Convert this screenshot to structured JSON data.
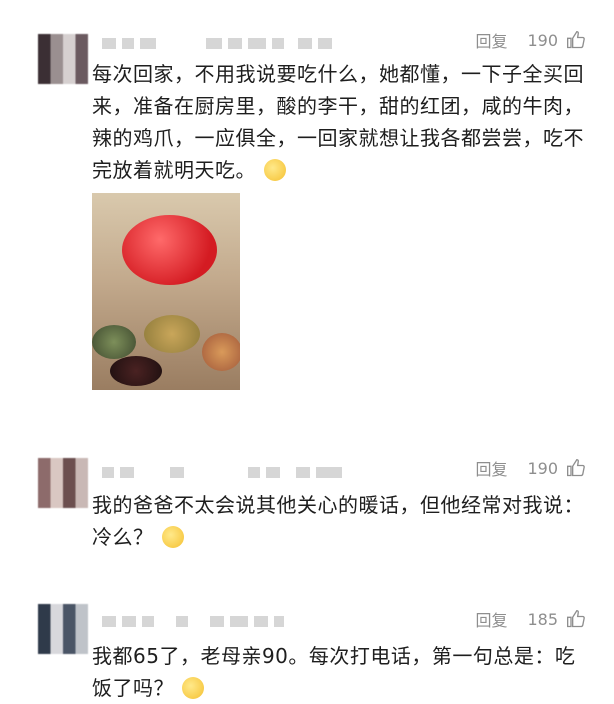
{
  "comments": [
    {
      "reply_label": "回复",
      "likes": "190",
      "text": "每次回家，不用我说要吃什么，她都懂，一下子全买回来，准备在厨房里，酸的李干，甜的红团，咸的牛肉，辣的鸡爪，一应俱全，一回家就想让我各都尝尝，吃不完放着就明天吃。",
      "emoji": "smiling-tear-emoji"
    },
    {
      "reply_label": "回复",
      "likes": "190",
      "text": "我的爸爸不太会说其他关心的暖话，但他经常对我说：冷么？",
      "emoji": "pleading-face-emoji"
    },
    {
      "reply_label": "回复",
      "likes": "185",
      "text": "我都65了，老母亲90。每次打电话，第一句总是：吃饭了吗？",
      "emoji": "crying-face-emoji"
    }
  ],
  "colors": {
    "text": "#1e1e1e",
    "meta": "#8e8e8e",
    "background": "#ffffff"
  }
}
